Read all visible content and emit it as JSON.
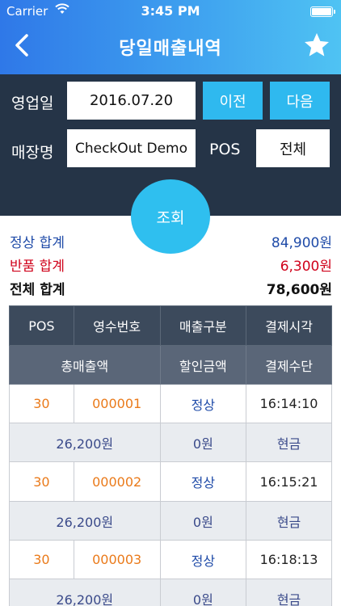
{
  "status": {
    "carrier": "Carrier",
    "time": "3:45 PM"
  },
  "nav": {
    "title": "당일매출내역"
  },
  "filters": {
    "date_label": "영업일",
    "date_value": "2016.07.20",
    "prev_label": "이전",
    "next_label": "다음",
    "store_label": "매장명",
    "store_value": "CheckOut Demo",
    "pos_label": "POS",
    "pos_value": "전체",
    "search_label": "조회"
  },
  "totals": {
    "normal_label": "정상 합계",
    "normal_value": "84,900원",
    "return_label": "반품 합계",
    "return_value": "6,300원",
    "total_label": "전체 합계",
    "total_value": "78,600원"
  },
  "table": {
    "headers_row1": [
      "POS",
      "영수번호",
      "매출구분",
      "결제시각"
    ],
    "headers_row2": [
      "총매출액",
      "할인금액",
      "결제수단"
    ],
    "records": [
      {
        "pos": "30",
        "receipt": "000001",
        "type": "정상",
        "time": "16:14:10",
        "amount": "26,200원",
        "discount": "0원",
        "method": "현금"
      },
      {
        "pos": "30",
        "receipt": "000002",
        "type": "정상",
        "time": "16:15:21",
        "amount": "26,200원",
        "discount": "0원",
        "method": "현금"
      },
      {
        "pos": "30",
        "receipt": "000003",
        "type": "정상",
        "time": "16:18:13",
        "amount": "26,200원",
        "discount": "0원",
        "method": "현금"
      }
    ]
  },
  "colors": {
    "header_gradient_start": "#2f78e8",
    "header_gradient_end": "#4fc3f3",
    "panel_bg": "#253447",
    "accent": "#2fb9ef",
    "normal_total": "#1f4ba8",
    "return_total": "#d0021b",
    "pos_text": "#ea7a1a"
  }
}
